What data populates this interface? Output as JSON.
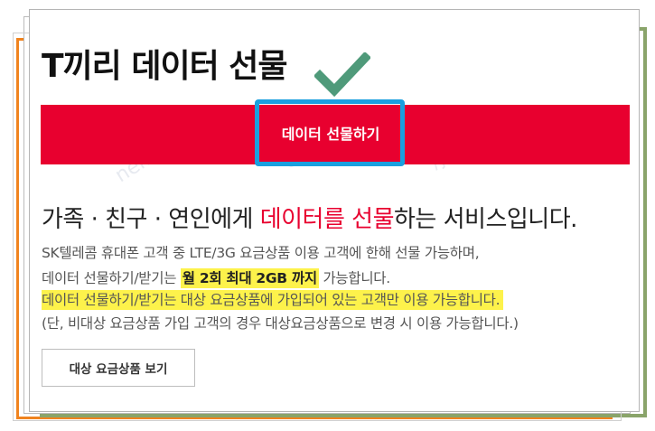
{
  "page": {
    "title": "T끼리 데이터 선물",
    "gift_button_label": "데이터 선물하기",
    "headline": {
      "before": "가족 · 친구 · 연인에게 ",
      "accent": "데이터를 선물",
      "after": "하는 서비스입니다."
    },
    "desc": {
      "line1": "SK텔레콤 휴대폰 고객 중 LTE/3G 요금상품 이용 고객에 한해 선물 가능하며,",
      "line2_before": "데이터 선물하기/받기는 ",
      "line2_strong": "월 2회 최대 2GB 까지",
      "line2_after": " 가능합니다.",
      "line3": "데이터 선물하기/받기는 대상 요금상품에 가입되어 있는 고객만 이용 가능합니다.",
      "line4": "(단, 비대상 요금상품 가입 고객의 경우 대상요금상품으로 변경 시 이용 가능합니다.)"
    },
    "plan_button_label": "대상 요금상품 보기"
  },
  "watermark": {
    "text1": "ner.com/joo",
    "text2": "/joonggon",
    "text3": "중고나라"
  },
  "colors": {
    "brand_red": "#e8002f",
    "highlight_blue": "#1aa0df",
    "marker_yellow": "#fdf24b",
    "check_green": "#4f9a7a"
  },
  "icons": {
    "annotation": "checkmark-icon"
  }
}
